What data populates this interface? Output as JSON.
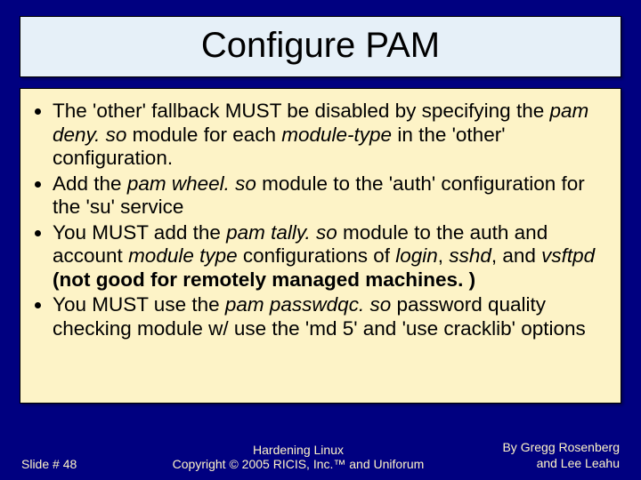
{
  "title": "Configure PAM",
  "bullets": {
    "b1_a": "The 'other' fallback MUST be disabled by specifying the ",
    "b1_i1": "pam deny. so",
    "b1_b": " module for each ",
    "b1_i2": "module-type",
    "b1_c": " in the 'other' configuration.",
    "b2_a": "Add the ",
    "b2_i1": "pam wheel. so",
    "b2_b": " module to the 'auth' configuration for the 'su' service",
    "b3_a": "You MUST add the ",
    "b3_i1": "pam tally. so",
    "b3_b": " module to the auth and account ",
    "b3_i2": "module type",
    "b3_c": " configurations of ",
    "b3_i3": "login",
    "b3_d": ", ",
    "b3_i4": "sshd",
    "b3_e": ", and ",
    "b3_i5": "vsftpd",
    "b3_f": " ",
    "b3_bold": "(not good for remotely managed machines. )",
    "b4_a": "You MUST use the ",
    "b4_i1": "pam passwdqc. so",
    "b4_b": " password quality checking module w/ use the 'md 5' and 'use cracklib' options"
  },
  "footer": {
    "slide": "Slide # 48",
    "center1": "Hardening Linux",
    "center2": "Copyright © 2005 RICIS, Inc.™ and Uniforum",
    "right1": "By Gregg Rosenberg",
    "right2": "and Lee Leahu"
  }
}
